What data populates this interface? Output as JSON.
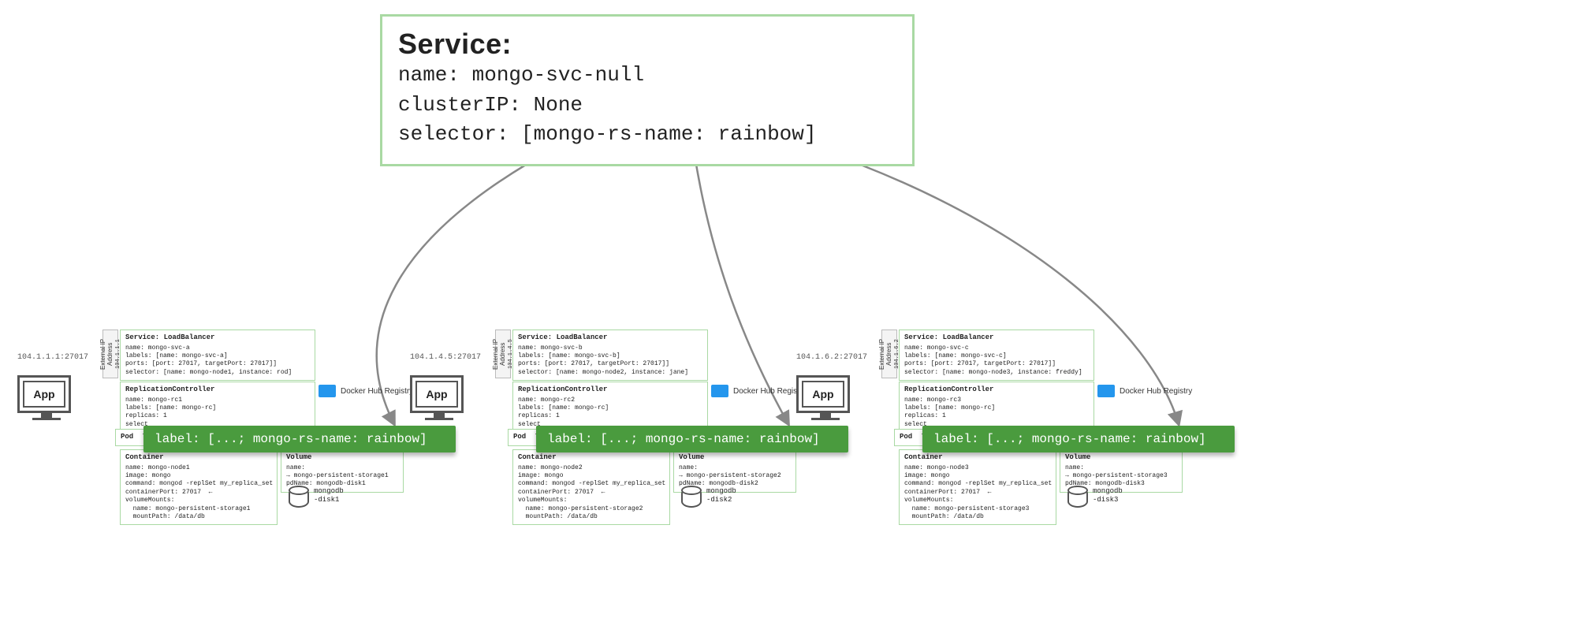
{
  "service": {
    "title": "Service:",
    "lines": {
      "name": "name: mongo-svc-null",
      "clusterIP": "clusterIP: None",
      "selector": "selector: [mongo-rs-name: rainbow]"
    }
  },
  "label_badge": "label: [...; mongo-rs-name: rainbow]",
  "docker_hub_label": "Docker Hub Registry",
  "ext_ip_label": "External IP Address",
  "clusters": [
    {
      "ext_ip": "104.1.1.1:27017",
      "ext_ip_addr": "104.1.1.1",
      "app_label": "App",
      "service_lb": {
        "title": "Service: LoadBalancer",
        "body": "name: mongo-svc-a\nlabels: [name: mongo-svc-a]\nports: [port: 27017, targetPort: 27017]]\nselector: [name: mongo-node1, instance: rod]"
      },
      "rc": {
        "title": "ReplicationController",
        "body": "name: mongo-rc1\nlabels: [name: mongo-rc]\nreplicas: 1\nselect"
      },
      "pod": {
        "title": "Pod",
        "body": "label"
      },
      "container": {
        "title": "Container",
        "body": "name: mongo-node1\nimage: mongo\ncommand: mongod -replSet my_replica_set\ncontainerPort: 27017  ←\nvolumeMounts:\n  name: mongo-persistent-storage1\n  mountPath: /data/db"
      },
      "volume": {
        "title": "Volume",
        "body": "name:\n→ mongo-persistent-storage1\npdName: mongodb-disk1"
      },
      "db_label": "mongodb\n-disk1"
    },
    {
      "ext_ip": "104.1.4.5:27017",
      "ext_ip_addr": "104.1.4.5",
      "app_label": "App",
      "service_lb": {
        "title": "Service: LoadBalancer",
        "body": "name: mongo-svc-b\nlabels: [name: mongo-svc-b]\nports: [port: 27017, targetPort: 27017]]\nselector: [name: mongo-node2, instance: jane]"
      },
      "rc": {
        "title": "ReplicationController",
        "body": "name: mongo-rc2\nlabels: [name: mongo-rc]\nreplicas: 1\nselect"
      },
      "pod": {
        "title": "Pod",
        "body": "label"
      },
      "container": {
        "title": "Container",
        "body": "name: mongo-node2\nimage: mongo\ncommand: mongod -replSet my_replica_set\ncontainerPort: 27017  ←\nvolumeMounts:\n  name: mongo-persistent-storage2\n  mountPath: /data/db"
      },
      "volume": {
        "title": "Volume",
        "body": "name:\n→ mongo-persistent-storage2\npdName: mongodb-disk2"
      },
      "db_label": "mongodb\n-disk2"
    },
    {
      "ext_ip": "104.1.6.2:27017",
      "ext_ip_addr": "104.1.6.2",
      "app_label": "App",
      "service_lb": {
        "title": "Service: LoadBalancer",
        "body": "name: mongo-svc-c\nlabels: [name: mongo-svc-c]\nports: [port: 27017, targetPort: 27017]]\nselector: [name: mongo-node3, instance: freddy]"
      },
      "rc": {
        "title": "ReplicationController",
        "body": "name: mongo-rc3\nlabels: [name: mongo-rc]\nreplicas: 1\nselect"
      },
      "pod": {
        "title": "Pod",
        "body": "labels"
      },
      "container": {
        "title": "Container",
        "body": "name: mongo-node3\nimage: mongo\ncommand: mongod -replSet my_replica_set\ncontainerPort: 27017  ←\nvolumeMounts:\n  name: mongo-persistent-storage3\n  mountPath: /data/db"
      },
      "volume": {
        "title": "Volume",
        "body": "name:\n→ mongo-persistent-storage3\npdName: mongodb-disk3"
      },
      "db_label": "mongodb\n-disk3"
    }
  ]
}
